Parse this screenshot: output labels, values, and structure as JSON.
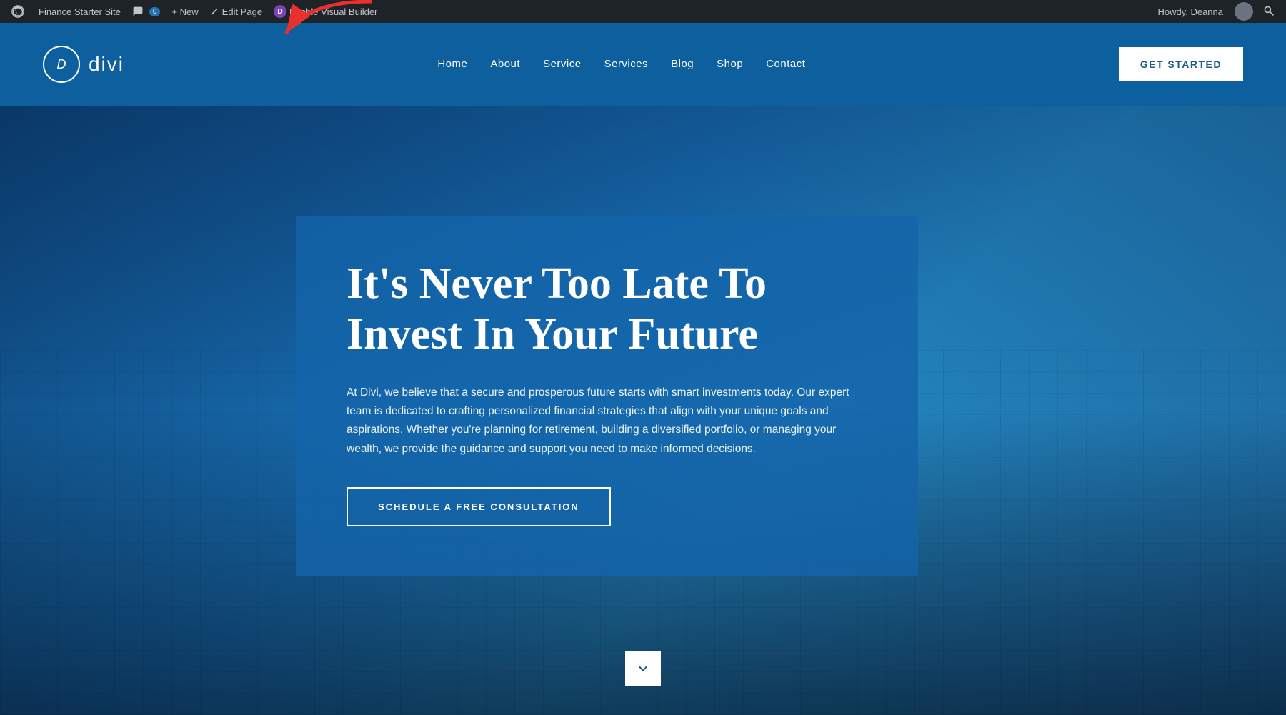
{
  "adminBar": {
    "siteName": "Finance Starter Site",
    "commentCount": "0",
    "newLabel": "+ New",
    "editPageLabel": "Edit Page",
    "visualBuilderLabel": "Enable Visual Builder",
    "howdy": "Howdy, Deanna"
  },
  "header": {
    "logoText": "divi",
    "logoInitial": "D",
    "nav": [
      {
        "label": "Home"
      },
      {
        "label": "About"
      },
      {
        "label": "Service"
      },
      {
        "label": "Services"
      },
      {
        "label": "Blog"
      },
      {
        "label": "Shop"
      },
      {
        "label": "Contact"
      }
    ],
    "ctaButton": "GET STARTED"
  },
  "hero": {
    "title": "It's Never Too Late To Invest In Your Future",
    "description": "At Divi, we believe that a secure and prosperous future starts with smart investments today. Our expert team is dedicated to crafting personalized financial strategies that align with your unique goals and aspirations. Whether you're planning for retirement, building a diversified portfolio, or managing your wealth, we provide the guidance and support you need to make informed decisions.",
    "ctaButton": "SCHEDULE A FREE CONSULTATION"
  }
}
